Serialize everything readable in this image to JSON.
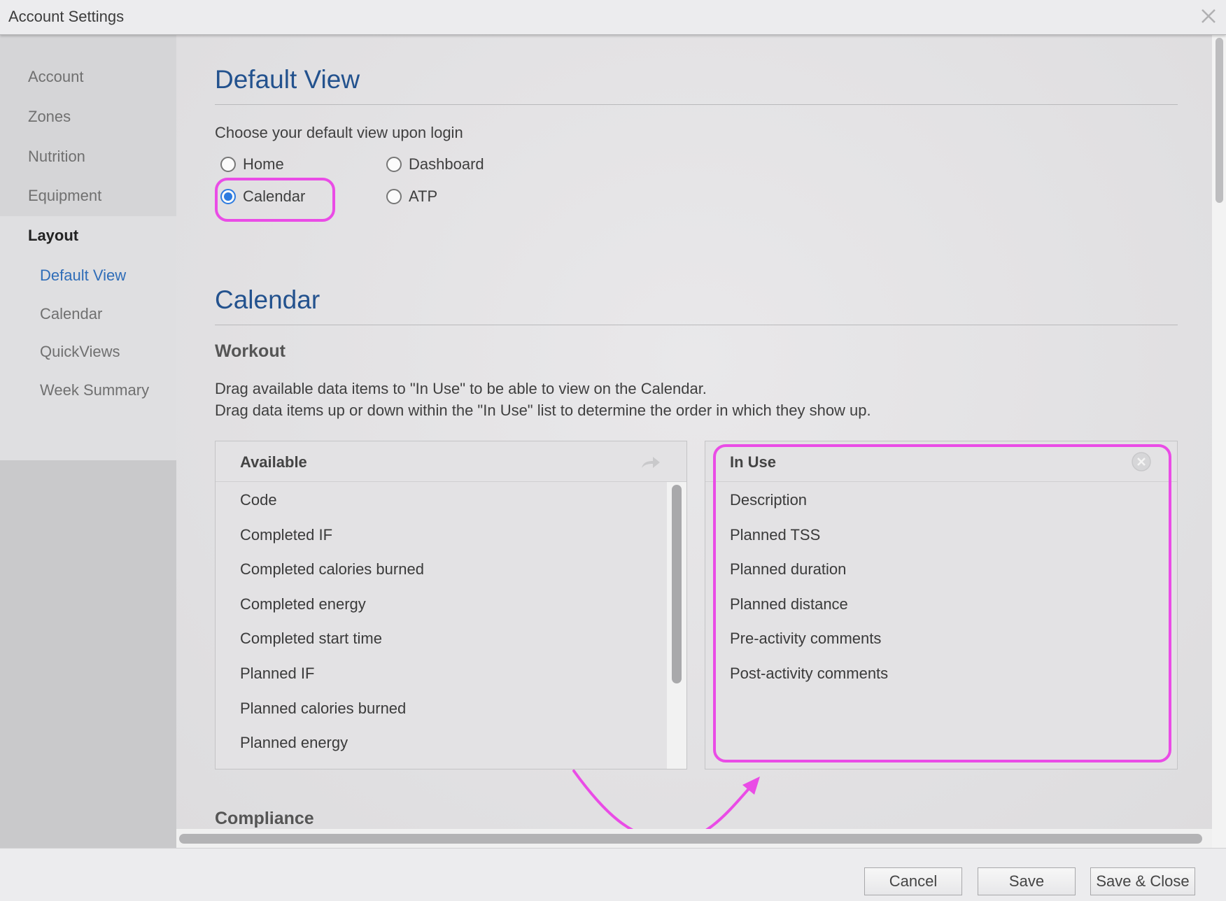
{
  "window": {
    "title": "Account Settings"
  },
  "sidebar": {
    "items": [
      {
        "label": "Account"
      },
      {
        "label": "Zones"
      },
      {
        "label": "Nutrition"
      },
      {
        "label": "Equipment"
      },
      {
        "label": "Layout"
      }
    ],
    "layout_subitems": [
      {
        "label": "Default View"
      },
      {
        "label": "Calendar"
      },
      {
        "label": "QuickViews"
      },
      {
        "label": "Week Summary"
      }
    ]
  },
  "default_view": {
    "heading": "Default View",
    "prompt": "Choose your default view upon login",
    "options": [
      {
        "label": "Home",
        "checked": false
      },
      {
        "label": "Dashboard",
        "checked": false
      },
      {
        "label": "Calendar",
        "checked": true
      },
      {
        "label": "ATP",
        "checked": false
      }
    ]
  },
  "calendar": {
    "heading": "Calendar",
    "workout_heading": "Workout",
    "instructions": [
      "Drag available data items to \"In Use\" to be able to view on the Calendar.",
      "Drag data items up or down within the \"In Use\" list to determine the order in which they show up."
    ],
    "available": {
      "title": "Available",
      "items": [
        "Code",
        "Completed IF",
        "Completed calories burned",
        "Completed energy",
        "Completed start time",
        "Planned IF",
        "Planned calories burned",
        "Planned energy"
      ]
    },
    "in_use": {
      "title": "In Use",
      "items": [
        "Description",
        "Planned TSS",
        "Planned duration",
        "Planned distance",
        "Pre-activity comments",
        "Post-activity comments"
      ]
    },
    "compliance_heading": "Compliance"
  },
  "footer": {
    "cancel_label": "Cancel",
    "save_label": "Save",
    "save_close_label": "Save & Close"
  },
  "colors": {
    "accent": "#23528e",
    "link": "#2f6db8",
    "radio_checked": "#2d7be0",
    "annotation": "#ea4ce6"
  }
}
